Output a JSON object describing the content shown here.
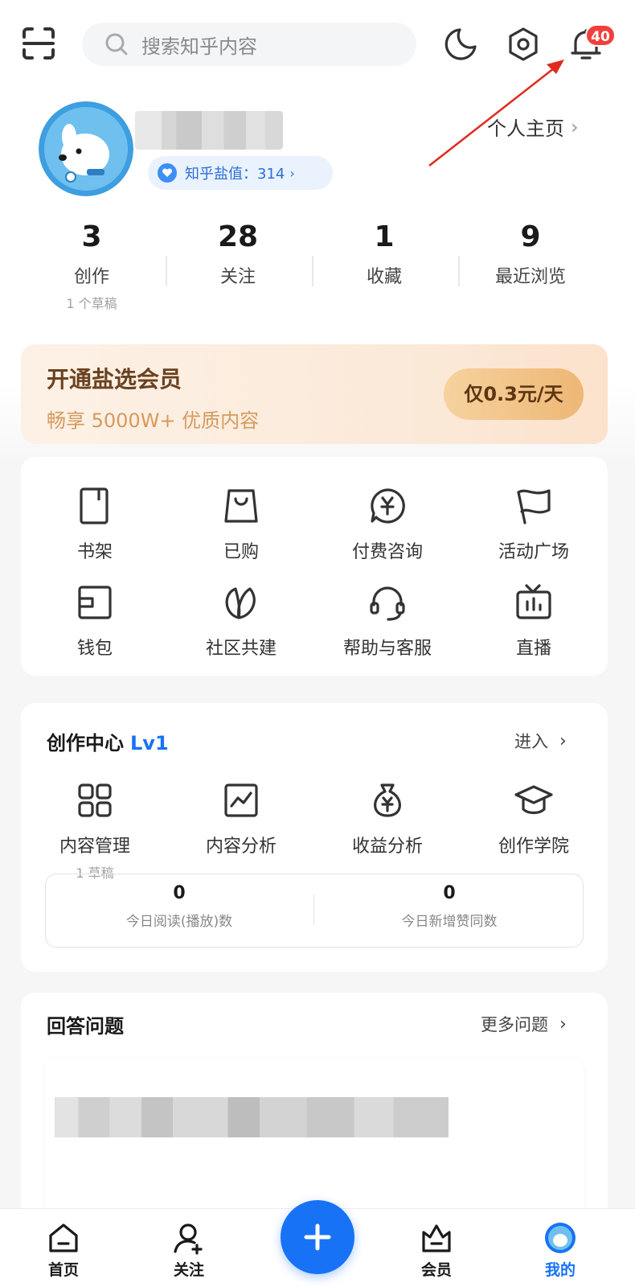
{
  "search": {
    "placeholder": "搜索知乎内容"
  },
  "notifications": {
    "badge": "40"
  },
  "profile": {
    "salt_label": "知乎盐值：314",
    "homepage_label": "个人主页"
  },
  "stats": [
    {
      "value": "3",
      "label": "创作",
      "sub": "1 个草稿"
    },
    {
      "value": "28",
      "label": "关注"
    },
    {
      "value": "1",
      "label": "收藏"
    },
    {
      "value": "9",
      "label": "最近浏览"
    }
  ],
  "vip": {
    "title": "开通盐选会员",
    "subtitle": "畅享 5000W+ 优质内容",
    "button": "仅0.3元/天"
  },
  "services": [
    {
      "label": "书架",
      "icon": "bookshelf-icon"
    },
    {
      "label": "已购",
      "icon": "shopping-bag-icon"
    },
    {
      "label": "付费咨询",
      "icon": "yen-chat-icon"
    },
    {
      "label": "活动广场",
      "icon": "flag-icon"
    },
    {
      "label": "钱包",
      "icon": "wallet-icon"
    },
    {
      "label": "社区共建",
      "icon": "leaf-icon"
    },
    {
      "label": "帮助与客服",
      "icon": "headset-icon"
    },
    {
      "label": "直播",
      "icon": "tv-icon"
    }
  ],
  "creation": {
    "title": "创作中心",
    "level": "Lv1",
    "enter": "进入",
    "items": [
      {
        "label": "内容管理",
        "sub": "1 草稿",
        "icon": "grid-icon"
      },
      {
        "label": "内容分析",
        "icon": "chart-icon"
      },
      {
        "label": "收益分析",
        "icon": "money-bag-icon"
      },
      {
        "label": "创作学院",
        "icon": "graduation-cap-icon"
      }
    ],
    "today": [
      {
        "value": "0",
        "label": "今日阅读(播放)数"
      },
      {
        "value": "0",
        "label": "今日新增赞同数"
      }
    ]
  },
  "answer": {
    "title": "回答问题",
    "more": "更多问题"
  },
  "nav": [
    {
      "label": "首页",
      "icon": "home-icon"
    },
    {
      "label": "关注",
      "icon": "follow-icon"
    },
    {
      "label": "会员",
      "icon": "vip-bag-icon"
    },
    {
      "label": "我的",
      "icon": "me-avatar-icon"
    }
  ],
  "colors": {
    "accent": "#1772f6",
    "badge": "#f1403c",
    "vip_text": "#6a4220"
  }
}
